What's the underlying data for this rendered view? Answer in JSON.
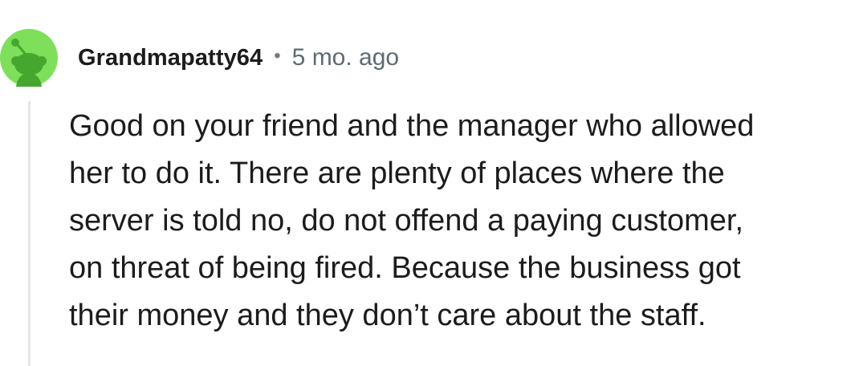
{
  "comment": {
    "username": "Grandmapatty64",
    "separator": "•",
    "timestamp": "5 mo. ago",
    "body_lines": [
      "Good on your friend and the manager who allowed",
      "her to do it. There are plenty of places where the",
      "server is told no, do not offend a paying customer,",
      "on threat of being fired. Because the business got",
      "their money and they don’t care about the staff."
    ]
  },
  "avatar": {
    "icon": "snoo-avatar-icon",
    "background_color": "#7ee05a",
    "figure_color": "#46a72f"
  },
  "colors": {
    "text": "#1c1c1c",
    "meta": "#5e6b72",
    "thread_line": "#e3e5e6"
  }
}
